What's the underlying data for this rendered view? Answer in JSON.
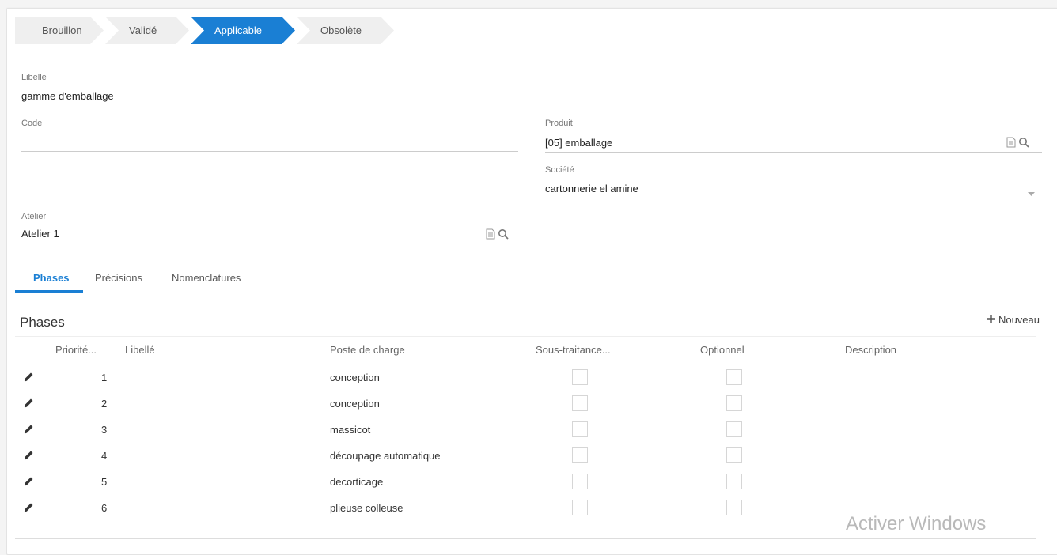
{
  "steps": [
    {
      "label": "Brouillon",
      "active": false
    },
    {
      "label": "Validé",
      "active": false
    },
    {
      "label": "Applicable",
      "active": true
    },
    {
      "label": "Obsolète",
      "active": false
    }
  ],
  "form": {
    "libelle_label": "Libellé",
    "libelle_value": "gamme d'emballage",
    "code_label": "Code",
    "code_value": "",
    "produit_label": "Produit",
    "produit_value": "[05] emballage",
    "societe_label": "Société",
    "societe_value": "cartonnerie el amine",
    "atelier_label": "Atelier",
    "atelier_value": "Atelier 1"
  },
  "tabs": [
    {
      "label": "Phases",
      "active": true
    },
    {
      "label": "Précisions",
      "active": false
    },
    {
      "label": "Nomenclatures",
      "active": false
    }
  ],
  "phases": {
    "title": "Phases",
    "new_label": "Nouveau",
    "columns": [
      "Priorité...",
      "Libellé",
      "Poste de charge",
      "Sous-traitance...",
      "Optionnel",
      "Description"
    ],
    "rows": [
      {
        "priorite": "1",
        "libelle": "",
        "poste": "conception",
        "sous_traitance": false,
        "optionnel": false,
        "description": ""
      },
      {
        "priorite": "2",
        "libelle": "",
        "poste": "conception",
        "sous_traitance": false,
        "optionnel": false,
        "description": ""
      },
      {
        "priorite": "3",
        "libelle": "",
        "poste": "massicot",
        "sous_traitance": false,
        "optionnel": false,
        "description": ""
      },
      {
        "priorite": "4",
        "libelle": "",
        "poste": "découpage automatique",
        "sous_traitance": false,
        "optionnel": false,
        "description": ""
      },
      {
        "priorite": "5",
        "libelle": "",
        "poste": "decorticage",
        "sous_traitance": false,
        "optionnel": false,
        "description": ""
      },
      {
        "priorite": "6",
        "libelle": "",
        "poste": "plieuse colleuse",
        "sous_traitance": false,
        "optionnel": false,
        "description": ""
      }
    ]
  },
  "watermark": "Activer Windows",
  "colors": {
    "accent": "#1a7fd4"
  },
  "icons": [
    "document-icon",
    "search-icon",
    "chevron-down-icon",
    "plus-icon",
    "pencil-icon"
  ]
}
